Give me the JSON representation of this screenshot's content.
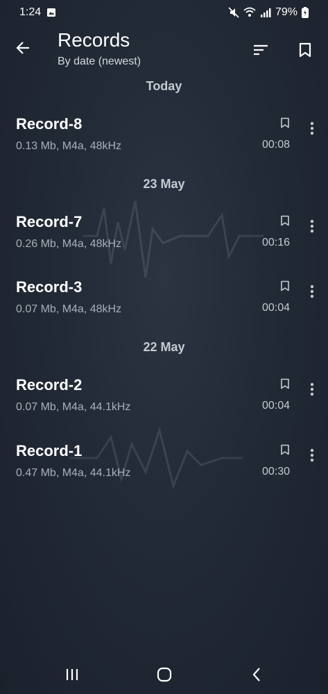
{
  "status_bar": {
    "time": "1:24",
    "battery": "79%"
  },
  "header": {
    "title": "Records",
    "subtitle": "By date (newest)"
  },
  "sections": [
    {
      "label": "Today",
      "records": [
        {
          "name": "Record-8",
          "meta": "0.13 Mb, M4a, 48kHz",
          "duration": "00:08"
        }
      ]
    },
    {
      "label": "23 May",
      "records": [
        {
          "name": "Record-7",
          "meta": "0.26 Mb, M4a, 48kHz",
          "duration": "00:16"
        },
        {
          "name": "Record-3",
          "meta": "0.07 Mb, M4a, 48kHz",
          "duration": "00:04"
        }
      ]
    },
    {
      "label": "22 May",
      "records": [
        {
          "name": "Record-2",
          "meta": "0.07 Mb, M4a, 44.1kHz",
          "duration": "00:04"
        },
        {
          "name": "Record-1",
          "meta": "0.47 Mb, M4a, 44.1kHz",
          "duration": "00:30"
        }
      ]
    }
  ],
  "icons": {
    "back": "arrow-left-icon",
    "sort": "sort-icon",
    "bookmarks": "bookmark-icon",
    "record_bookmark": "bookmark-outline-icon",
    "record_more": "more-vertical-icon",
    "nav_recents": "recents-icon",
    "nav_home": "home-icon",
    "nav_back": "chevron-left-icon"
  },
  "colors": {
    "background": "#222a36",
    "text_primary": "#ffffff",
    "text_secondary": "#a9b0ba",
    "section_header": "#c6cbd2"
  }
}
